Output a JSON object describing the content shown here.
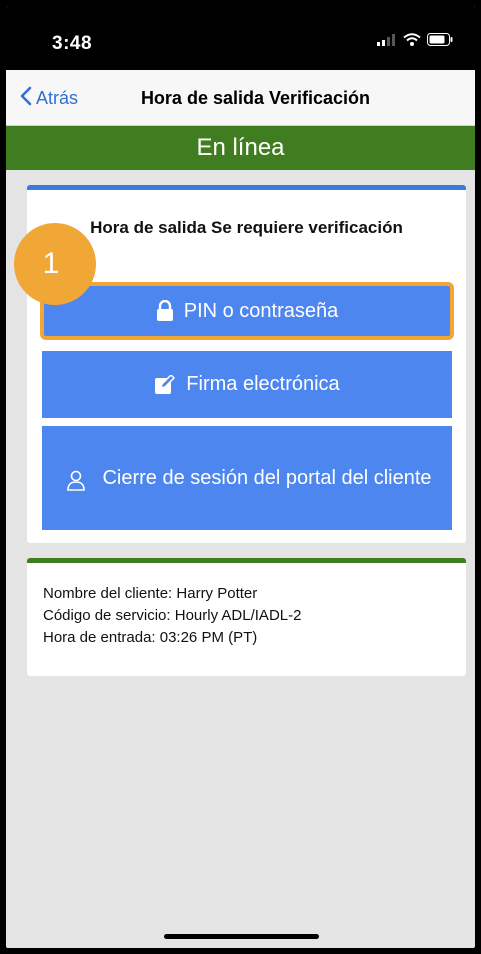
{
  "status_bar": {
    "time": "3:48"
  },
  "nav": {
    "back_label": "Atrás",
    "title": "Hora de salida Verificación"
  },
  "banner": {
    "text": "En línea"
  },
  "verification": {
    "title": "Hora de salida Se requiere verificación",
    "buttons": [
      {
        "label": "PIN o contraseña",
        "icon": "lock-icon"
      },
      {
        "label": "Firma electrónica",
        "icon": "signature-icon"
      },
      {
        "label": "Cierre de sesión del portal del cliente",
        "icon": "person-icon"
      }
    ]
  },
  "step_marker": "1",
  "client_info": {
    "name_line": "Nombre del cliente: Harry Potter",
    "service_line": "Código de servicio: Hourly ADL/IADL-2",
    "checkin_line": "Hora de entrada: 03:26 PM (PT)"
  },
  "colors": {
    "online_green": "#3f7d20",
    "button_blue": "#4c86ee",
    "highlight_orange": "#f0a735",
    "link_blue": "#2f6fd6"
  }
}
